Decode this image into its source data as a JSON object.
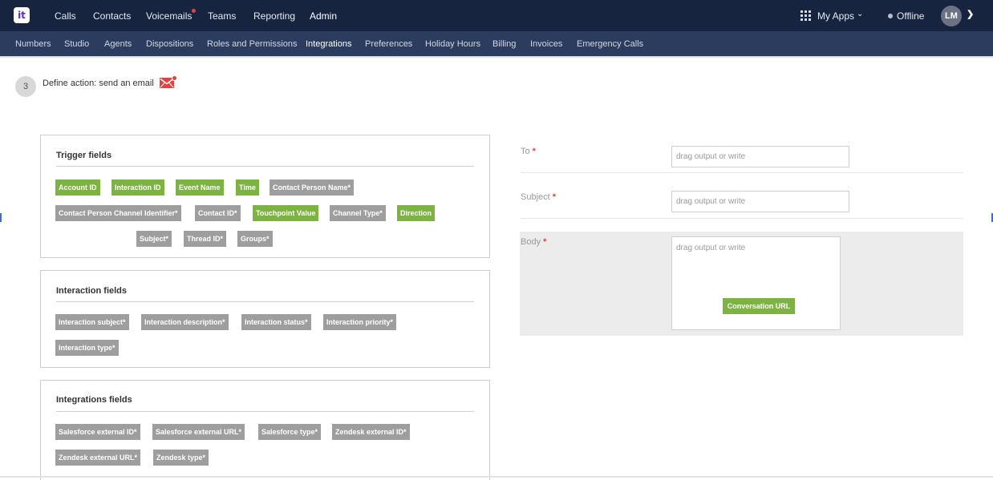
{
  "topnav": {
    "logo": "it",
    "items": [
      "Calls",
      "Contacts",
      "Voicemails",
      "Teams",
      "Reporting",
      "Admin"
    ],
    "active": "Admin",
    "myapps_label": "My Apps",
    "status_label": "Offline",
    "avatar_initials": "LM",
    "icons": {
      "apps": "grid-icon",
      "chevron": "chevron-down-icon",
      "status": "status-dot-icon"
    }
  },
  "subnav": {
    "items": [
      "Numbers",
      "Studio",
      "Agents",
      "Dispositions",
      "Roles and Permissions",
      "Integrations",
      "Preferences",
      "Holiday Hours",
      "Billing",
      "Invoices",
      "Emergency Calls"
    ],
    "active": "Integrations"
  },
  "step": {
    "number": "3",
    "title": "Define action: send an email",
    "icon": "email-icon"
  },
  "trigger_fields": {
    "title": "Trigger fields",
    "chips": [
      {
        "label": "Account ID",
        "color": "green"
      },
      {
        "label": "Interaction ID",
        "color": "green"
      },
      {
        "label": "Event Name",
        "color": "green"
      },
      {
        "label": "Time",
        "color": "green"
      },
      {
        "label": "Contact Person Name*",
        "color": "gray"
      },
      {
        "label": "Contact Person Channel Identifier*",
        "color": "gray"
      },
      {
        "label": "Contact ID*",
        "color": "gray"
      },
      {
        "label": "Touchpoint Value",
        "color": "green"
      },
      {
        "label": "Channel Type*",
        "color": "gray"
      },
      {
        "label": "Direction",
        "color": "green"
      },
      {
        "label": "Subject*",
        "color": "gray"
      },
      {
        "label": "Thread ID*",
        "color": "gray"
      },
      {
        "label": "Groups*",
        "color": "gray"
      }
    ]
  },
  "interaction_fields": {
    "title": "Interaction fields",
    "chips": [
      {
        "label": "Interaction subject*",
        "color": "gray"
      },
      {
        "label": "Interaction description*",
        "color": "gray"
      },
      {
        "label": "Interaction status*",
        "color": "gray"
      },
      {
        "label": "Interaction priority*",
        "color": "gray"
      },
      {
        "label": "Interaction type*",
        "color": "gray"
      }
    ]
  },
  "integrations_fields": {
    "title": "Integrations fields",
    "chips": [
      {
        "label": "Salesforce external ID*",
        "color": "gray"
      },
      {
        "label": "Salesforce external URL*",
        "color": "gray"
      },
      {
        "label": "Salesforce type*",
        "color": "gray"
      },
      {
        "label": "Zendesk external ID*",
        "color": "gray"
      },
      {
        "label": "Zendesk external URL*",
        "color": "gray"
      },
      {
        "label": "Zendesk type*",
        "color": "gray"
      }
    ]
  },
  "email_form": {
    "to_label": "To",
    "subject_label": "Subject",
    "body_label": "Body",
    "required_mark": "*",
    "placeholder": "drag output or write",
    "body_chip": "Conversation URL"
  },
  "colors": {
    "nav": "#17243f",
    "subnav": "#2b3c5e",
    "green_chip": "#7cb342",
    "gray_chip": "#9e9e9e",
    "required": "#e8403e"
  }
}
